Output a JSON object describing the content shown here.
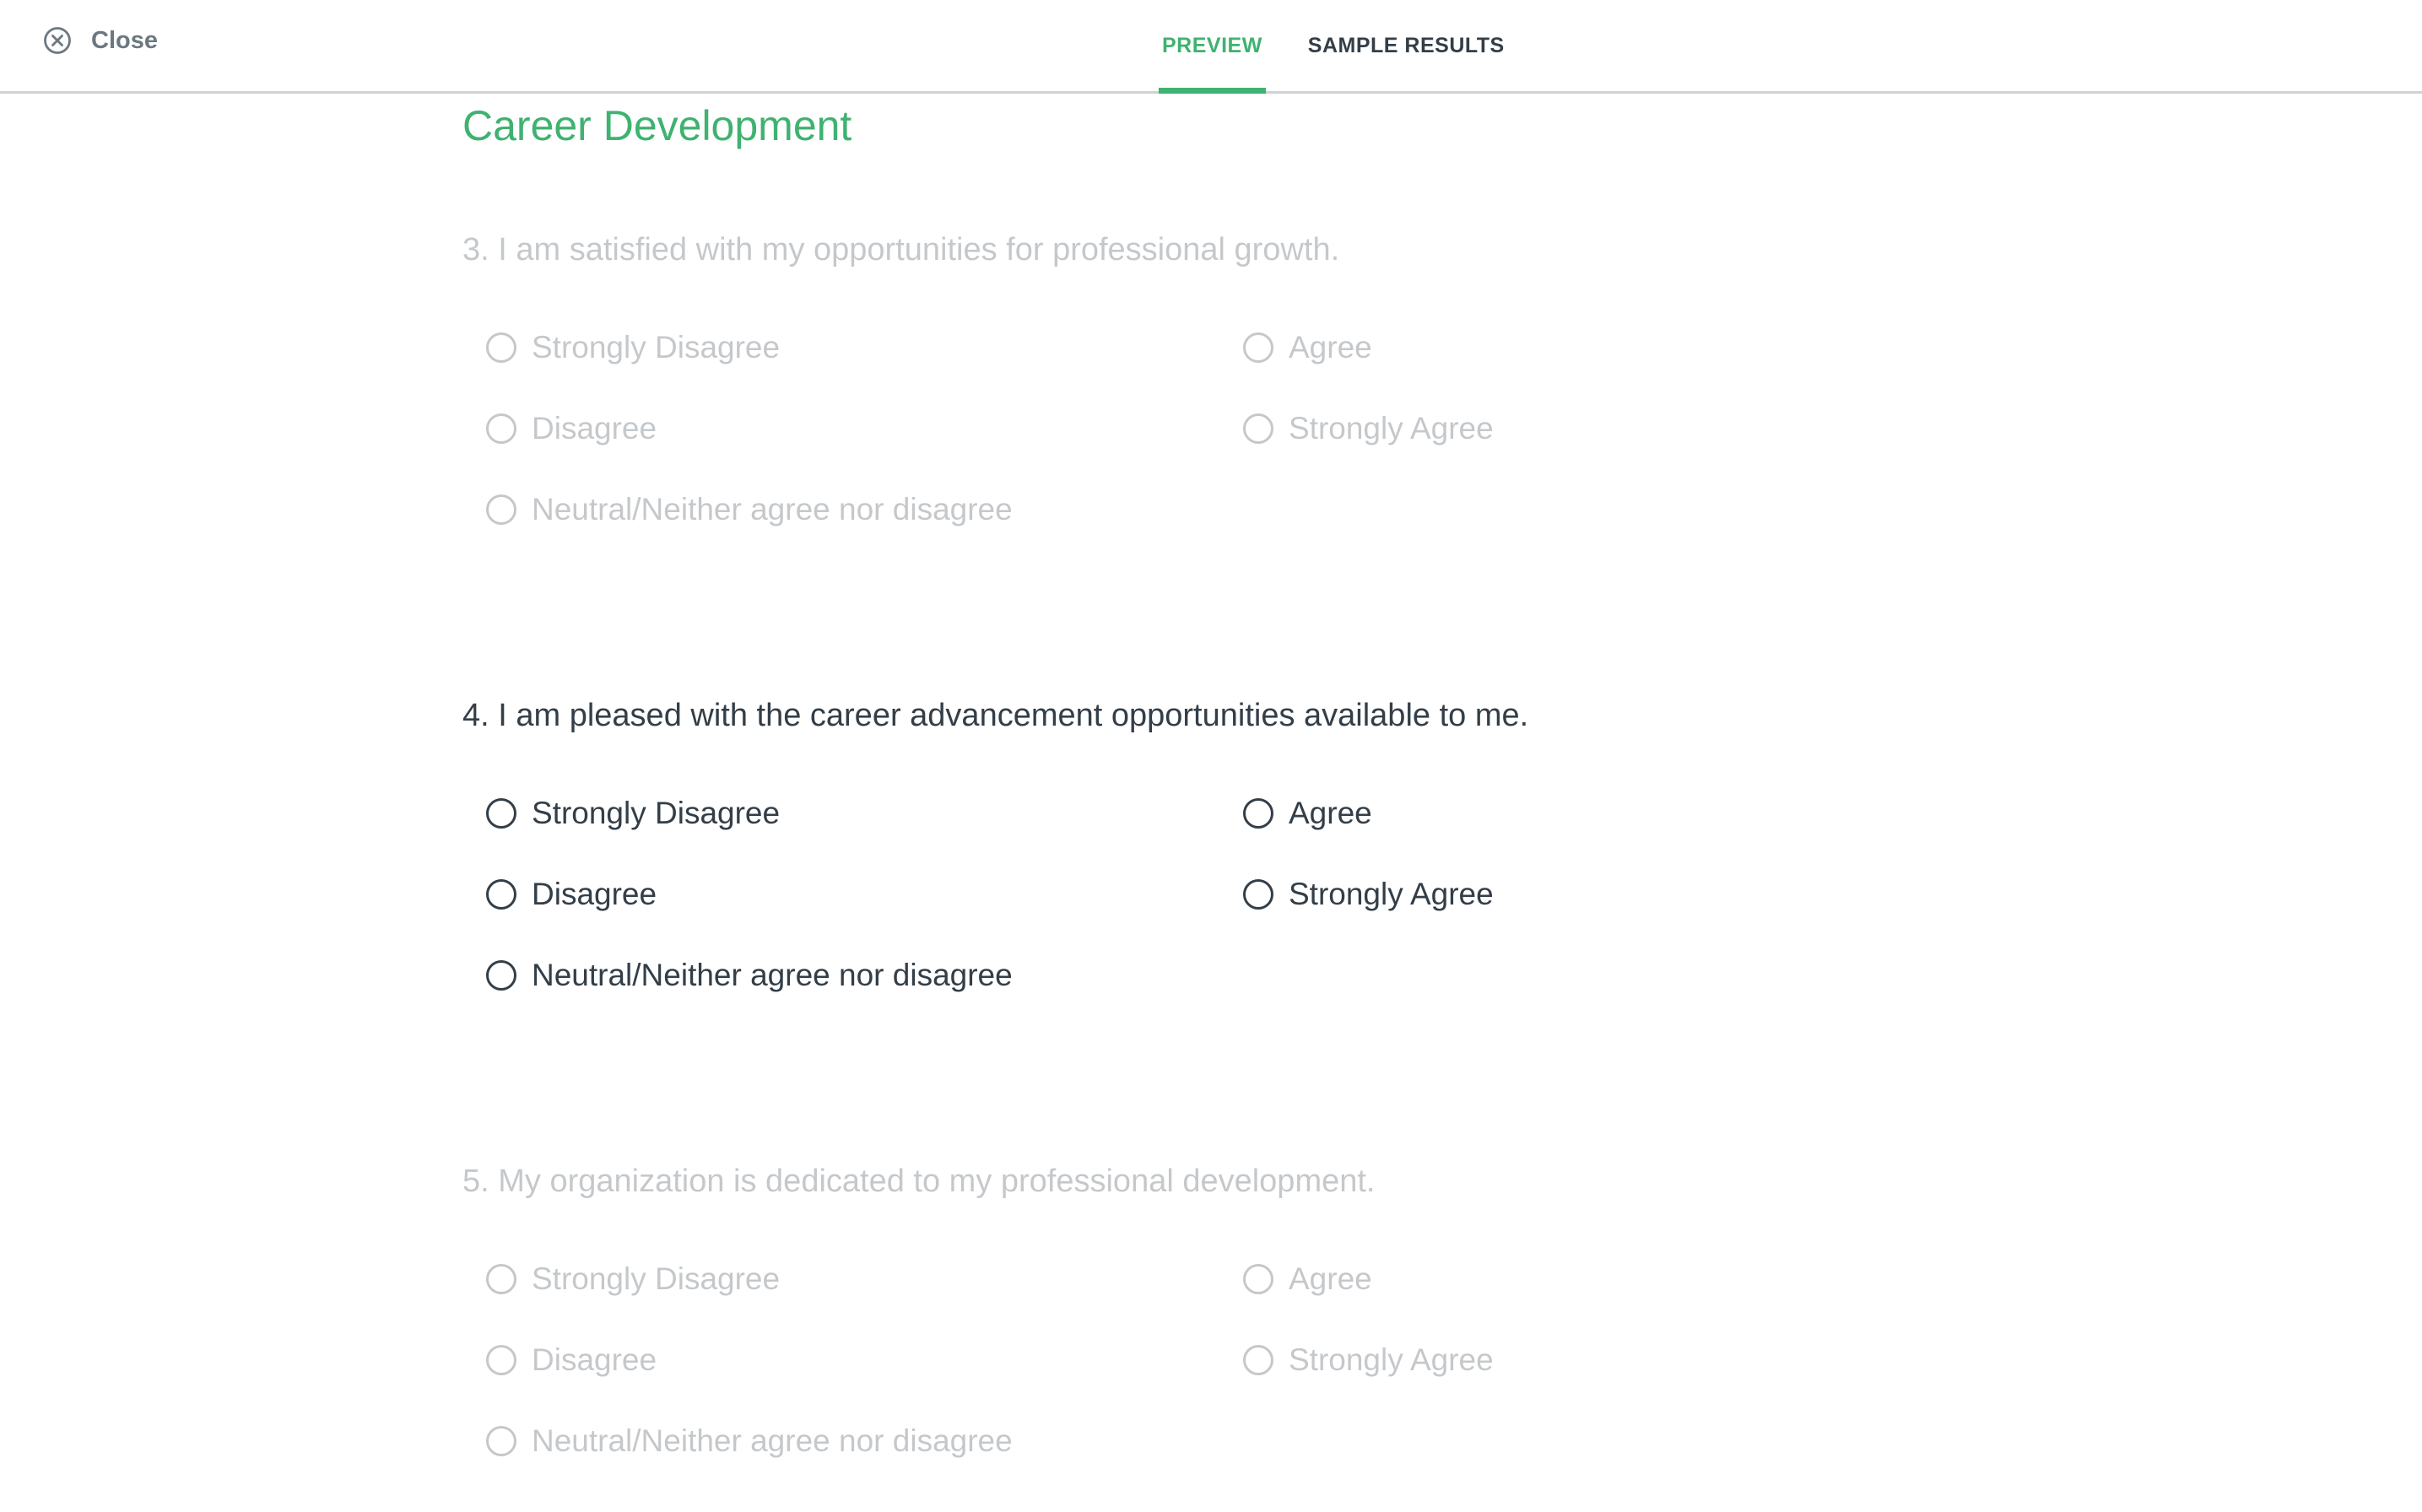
{
  "header": {
    "close_label": "Close",
    "tabs": [
      {
        "label": "PREVIEW",
        "active": true
      },
      {
        "label": "SAMPLE RESULTS",
        "active": false
      }
    ]
  },
  "page_title": "Career Development",
  "questions": [
    {
      "text": "3. I am satisfied with my opportunities for professional growth.",
      "state": "dimmed",
      "options": [
        "Strongly Disagree",
        "Disagree",
        "Neutral/Neither agree nor disagree",
        "Agree",
        "Strongly Agree"
      ]
    },
    {
      "text": "4. I am pleased with the career advancement opportunities available to me.",
      "state": "focused",
      "options": [
        "Strongly Disagree",
        "Disagree",
        "Neutral/Neither agree nor disagree",
        "Agree",
        "Strongly Agree"
      ]
    },
    {
      "text": "5. My organization is dedicated to my professional development.",
      "state": "dimmed",
      "options": [
        "Strongly Disagree",
        "Disagree",
        "Neutral/Neither agree nor disagree",
        "Agree",
        "Strongly Agree"
      ]
    }
  ],
  "colors": {
    "accent": "#3fb270",
    "text": "#333e48",
    "muted": "#6b787f",
    "divider": "#d0d2d3"
  },
  "icons": {
    "close": "close-circle-icon",
    "radio": "radio-unselected-icon"
  }
}
